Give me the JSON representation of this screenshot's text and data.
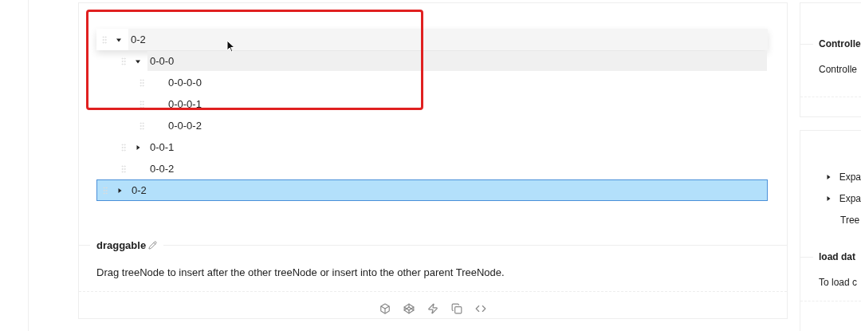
{
  "tree": {
    "nodes": [
      {
        "kind": "drag-preview",
        "label": "0-2",
        "expanded": true,
        "selected": false,
        "hovered": false,
        "children": [
          {
            "kind": "node",
            "label": "0-0-0",
            "expanded": true,
            "selected": false,
            "hovered": true,
            "children": [
              {
                "kind": "node",
                "label": "0-0-0-0",
                "selected": false,
                "hovered": false
              },
              {
                "kind": "node",
                "label": "0-0-0-1",
                "selected": false,
                "hovered": false
              },
              {
                "kind": "node",
                "label": "0-0-0-2",
                "selected": false,
                "hovered": false
              }
            ]
          },
          {
            "kind": "node",
            "label": "0-0-1",
            "expanded": false,
            "selected": false,
            "hovered": false
          },
          {
            "kind": "node",
            "label": "0-0-2",
            "selected": false,
            "hovered": false
          }
        ]
      },
      {
        "kind": "node",
        "label": "0-2",
        "expanded": false,
        "selected": true,
        "hovered": false
      }
    ]
  },
  "demo": {
    "title": "draggable",
    "description": "Drag treeNode to insert after the other treeNode or insert into the other parent TreeNode."
  },
  "right_cards": [
    {
      "title": "Controlle",
      "description": "Controlle"
    },
    {
      "tree": [
        {
          "label": "Expa",
          "expandable": true
        },
        {
          "label": "Expa",
          "expandable": true
        },
        {
          "label": "Tree",
          "expandable": false
        }
      ],
      "title": "load dat",
      "description": "To load c"
    }
  ]
}
